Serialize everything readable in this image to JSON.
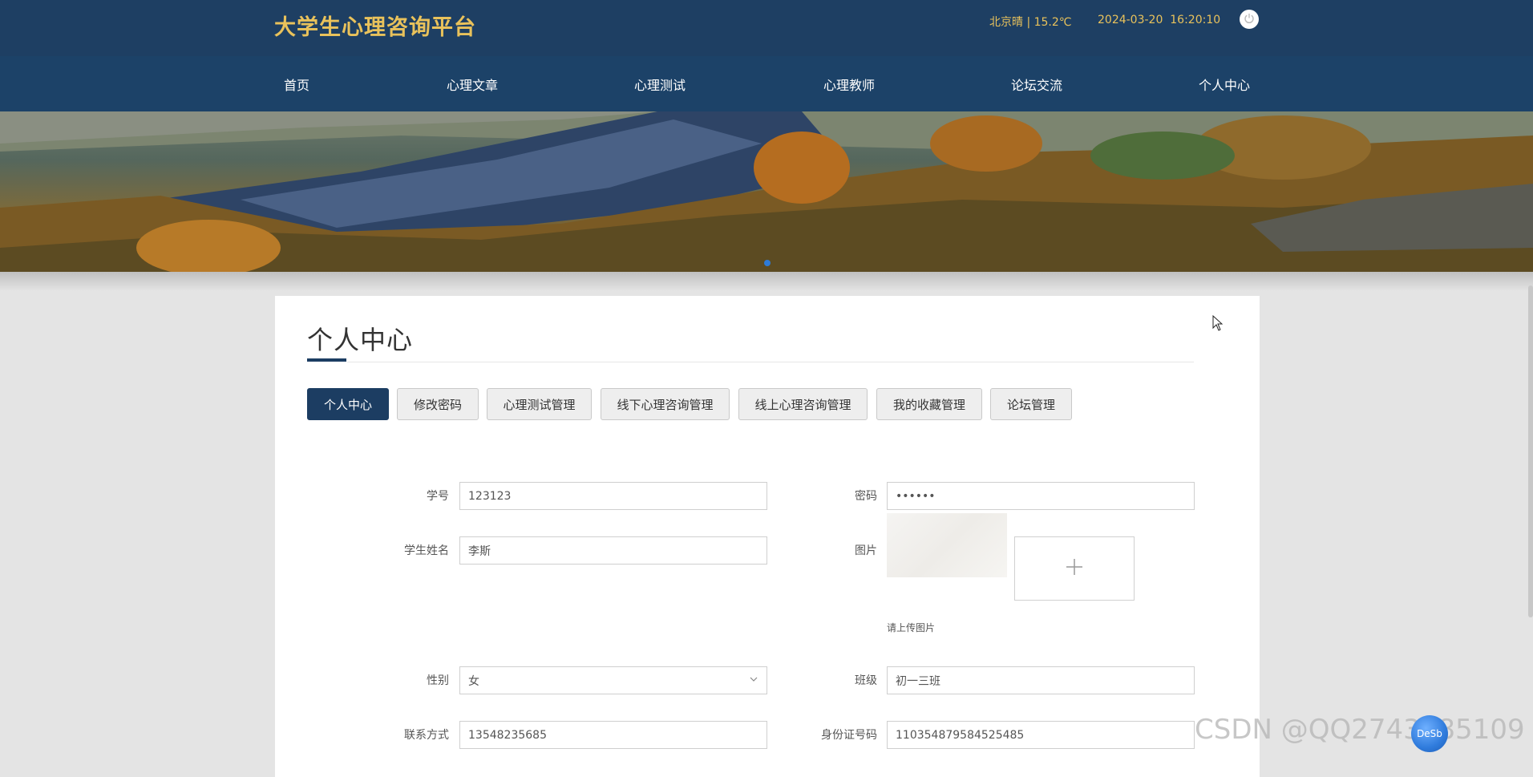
{
  "header": {
    "title": "大学生心理咨询平台",
    "weather": "北京晴 | 15.2℃",
    "datetime": "2024-03-20  16:20:10",
    "power_icon": "power-icon"
  },
  "nav": {
    "items": [
      "首页",
      "心理文章",
      "心理测试",
      "心理教师",
      "论坛交流",
      "个人中心"
    ]
  },
  "page": {
    "title": "个人中心"
  },
  "tabs": [
    "个人中心",
    "修改密码",
    "心理测试管理",
    "线下心理咨询管理",
    "线上心理咨询管理",
    "我的收藏管理",
    "论坛管理"
  ],
  "form": {
    "student_id": {
      "label": "学号",
      "value": "123123"
    },
    "password": {
      "label": "密码",
      "value": "••••••"
    },
    "name": {
      "label": "学生姓名",
      "value": "李斯"
    },
    "image": {
      "label": "图片",
      "hint": "请上传图片",
      "upload_icon": "plus-icon"
    },
    "gender": {
      "label": "性别",
      "value": "女"
    },
    "class": {
      "label": "班级",
      "value": "初一三班"
    },
    "phone": {
      "label": "联系方式",
      "value": "13548235685"
    },
    "id_card": {
      "label": "身份证号码",
      "value": "110354879584525485"
    }
  },
  "overlay": {
    "watermark": "CSDN @QQ2743785109",
    "float_ball": "DeSb"
  },
  "colors": {
    "header_bg": "#1e3f63",
    "nav_bg": "#1c4268",
    "title_gold": "#e9c25b",
    "active_tab": "#1c3d62"
  }
}
